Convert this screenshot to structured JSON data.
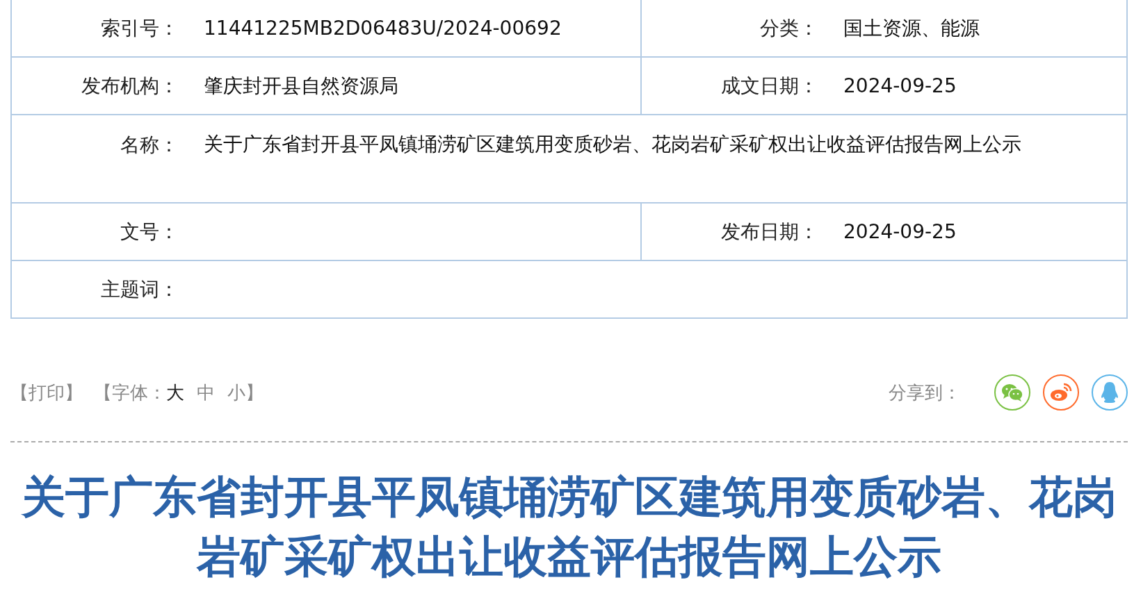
{
  "info_table": {
    "rows": [
      {
        "cells": [
          {
            "label": "索引号：",
            "value": "11441225MB2D06483U/2024-00692"
          },
          {
            "label": "分类：",
            "value": "国土资源、能源"
          }
        ]
      },
      {
        "cells": [
          {
            "label": "发布机构：",
            "value": "肇庆封开县自然资源局"
          },
          {
            "label": "成文日期：",
            "value": "2024-09-25"
          }
        ]
      },
      {
        "cells": [
          {
            "label": "名称：",
            "value": "关于广东省封开县平凤镇埇涝矿区建筑用变质砂岩、花岗岩矿采矿权出让收益评估报告网上公示"
          }
        ]
      },
      {
        "cells": [
          {
            "label": "文号："
          },
          {
            "label": "发布日期：",
            "value": "2024-09-25"
          }
        ]
      },
      {
        "cells": [
          {
            "label": "主题词："
          }
        ]
      }
    ]
  },
  "toolbar": {
    "print": "【打印】",
    "font_label": "【字体：",
    "font_sizes": [
      {
        "label": "大",
        "selected": true
      },
      {
        "label": "中",
        "selected": false
      },
      {
        "label": "小",
        "selected": false
      }
    ],
    "font_close": "】",
    "share_label": "分享到：",
    "share": [
      {
        "kind": "wechat",
        "color": "#7ac143"
      },
      {
        "kind": "weibo",
        "color": "#ff6a2b"
      },
      {
        "kind": "qq",
        "color": "#5ab4e8"
      }
    ]
  },
  "title": "关于广东省封开县平凤镇埇涝矿区建筑用变质砂岩、花岗岩矿采矿权出让收益评估报告网上公示"
}
